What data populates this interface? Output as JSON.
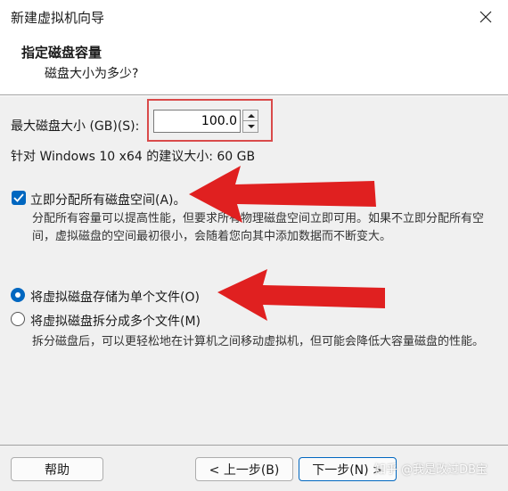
{
  "window": {
    "title": "新建虚拟机向导",
    "close_icon": "close-icon"
  },
  "header": {
    "title": "指定磁盘容量",
    "subtitle": "磁盘大小为多少?"
  },
  "disk_size": {
    "label": "最大磁盘大小 (GB)(S):",
    "value": "100.0",
    "recommended": "针对 Windows 10 x64 的建议大小: 60 GB"
  },
  "allocate": {
    "label": "立即分配所有磁盘空间(A)。",
    "checked": true,
    "description": "分配所有容量可以提高性能，但要求所有物理磁盘空间立即可用。如果不立即分配所有空间，虚拟磁盘的空间最初很小，会随着您向其中添加数据而不断变大。"
  },
  "storage_options": {
    "single_file_label": "将虚拟磁盘存储为单个文件(O)",
    "multi_file_label": "将虚拟磁盘拆分成多个文件(M)",
    "selected": "single",
    "multi_description": "拆分磁盘后，可以更轻松地在计算机之间移动虚拟机，但可能会降低大容量磁盘的性能。"
  },
  "buttons": {
    "help": "帮助",
    "back": "< 上一步(B)",
    "next": "下一步(N) >"
  },
  "watermark": "知乎 @我是改过DB宝",
  "colors": {
    "accent": "#0067c0",
    "annotation_red": "#e02020"
  }
}
